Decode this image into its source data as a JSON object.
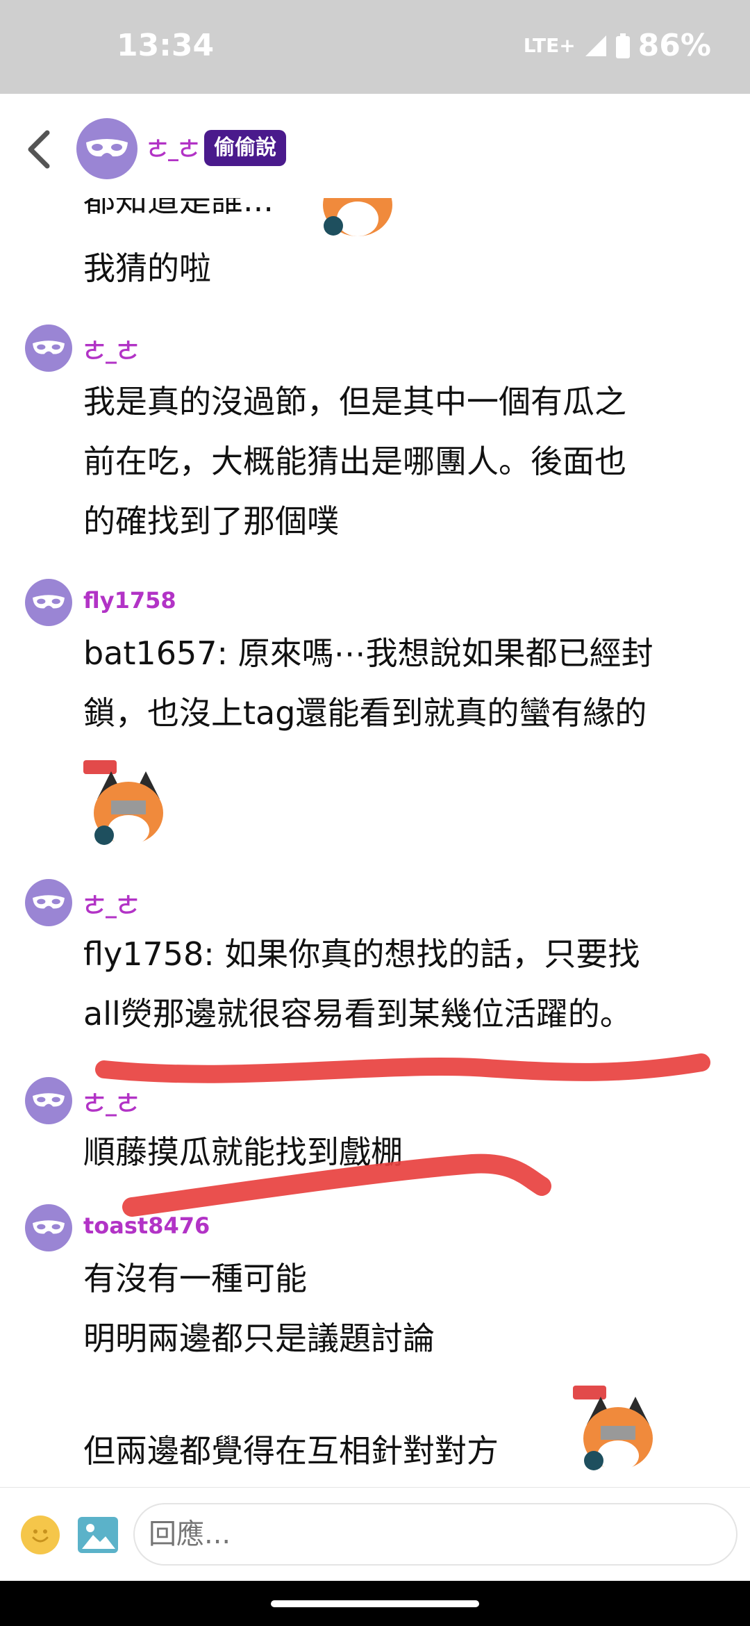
{
  "status": {
    "time": "13:34",
    "network": "LTE+",
    "battery": "86%"
  },
  "header": {
    "username": "ㄜ_ㄜ",
    "tag": "偷偷說"
  },
  "feed": {
    "prev_partial": "都知道是誰...",
    "prev_last": "我猜的啦",
    "messages": [
      {
        "user": "ㄜ_ㄜ",
        "lines": [
          "我是真的沒過節，但是其中一個有瓜之",
          "前在吃，大概能猜出是哪團人。後面也",
          "的確找到了那個噗"
        ]
      },
      {
        "user": "fly1758",
        "lines": [
          "bat1657: 原來嗎⋯我想說如果都已經封",
          "鎖，也沒上tag還能看到就真的蠻有緣的"
        ]
      },
      {
        "user": "ㄜ_ㄜ",
        "lines": [
          "fly1758: 如果你真的想找的話，只要找",
          "all熒那邊就很容易看到某幾位活躍的。"
        ]
      },
      {
        "user": "ㄜ_ㄜ",
        "lines": [
          "順藤摸瓜就能找到戲棚"
        ]
      },
      {
        "user": "toast8476",
        "lines": [
          "有沒有一種可能",
          "明明兩邊都只是議題討論",
          "",
          "但兩邊都覺得在互相針對對方"
        ]
      }
    ]
  },
  "composer": {
    "placeholder": "回應..."
  },
  "icons": {
    "back": "chevron-left-icon",
    "avatar": "mask-icon",
    "emoji": "smiley-icon",
    "image": "image-icon",
    "sticker": "fox-live-sticker"
  },
  "colors": {
    "username": "#b233c6",
    "tag_bg": "#4a1a8c",
    "avatar_bg": "#9a85d4",
    "highlight": "#e8413f"
  }
}
